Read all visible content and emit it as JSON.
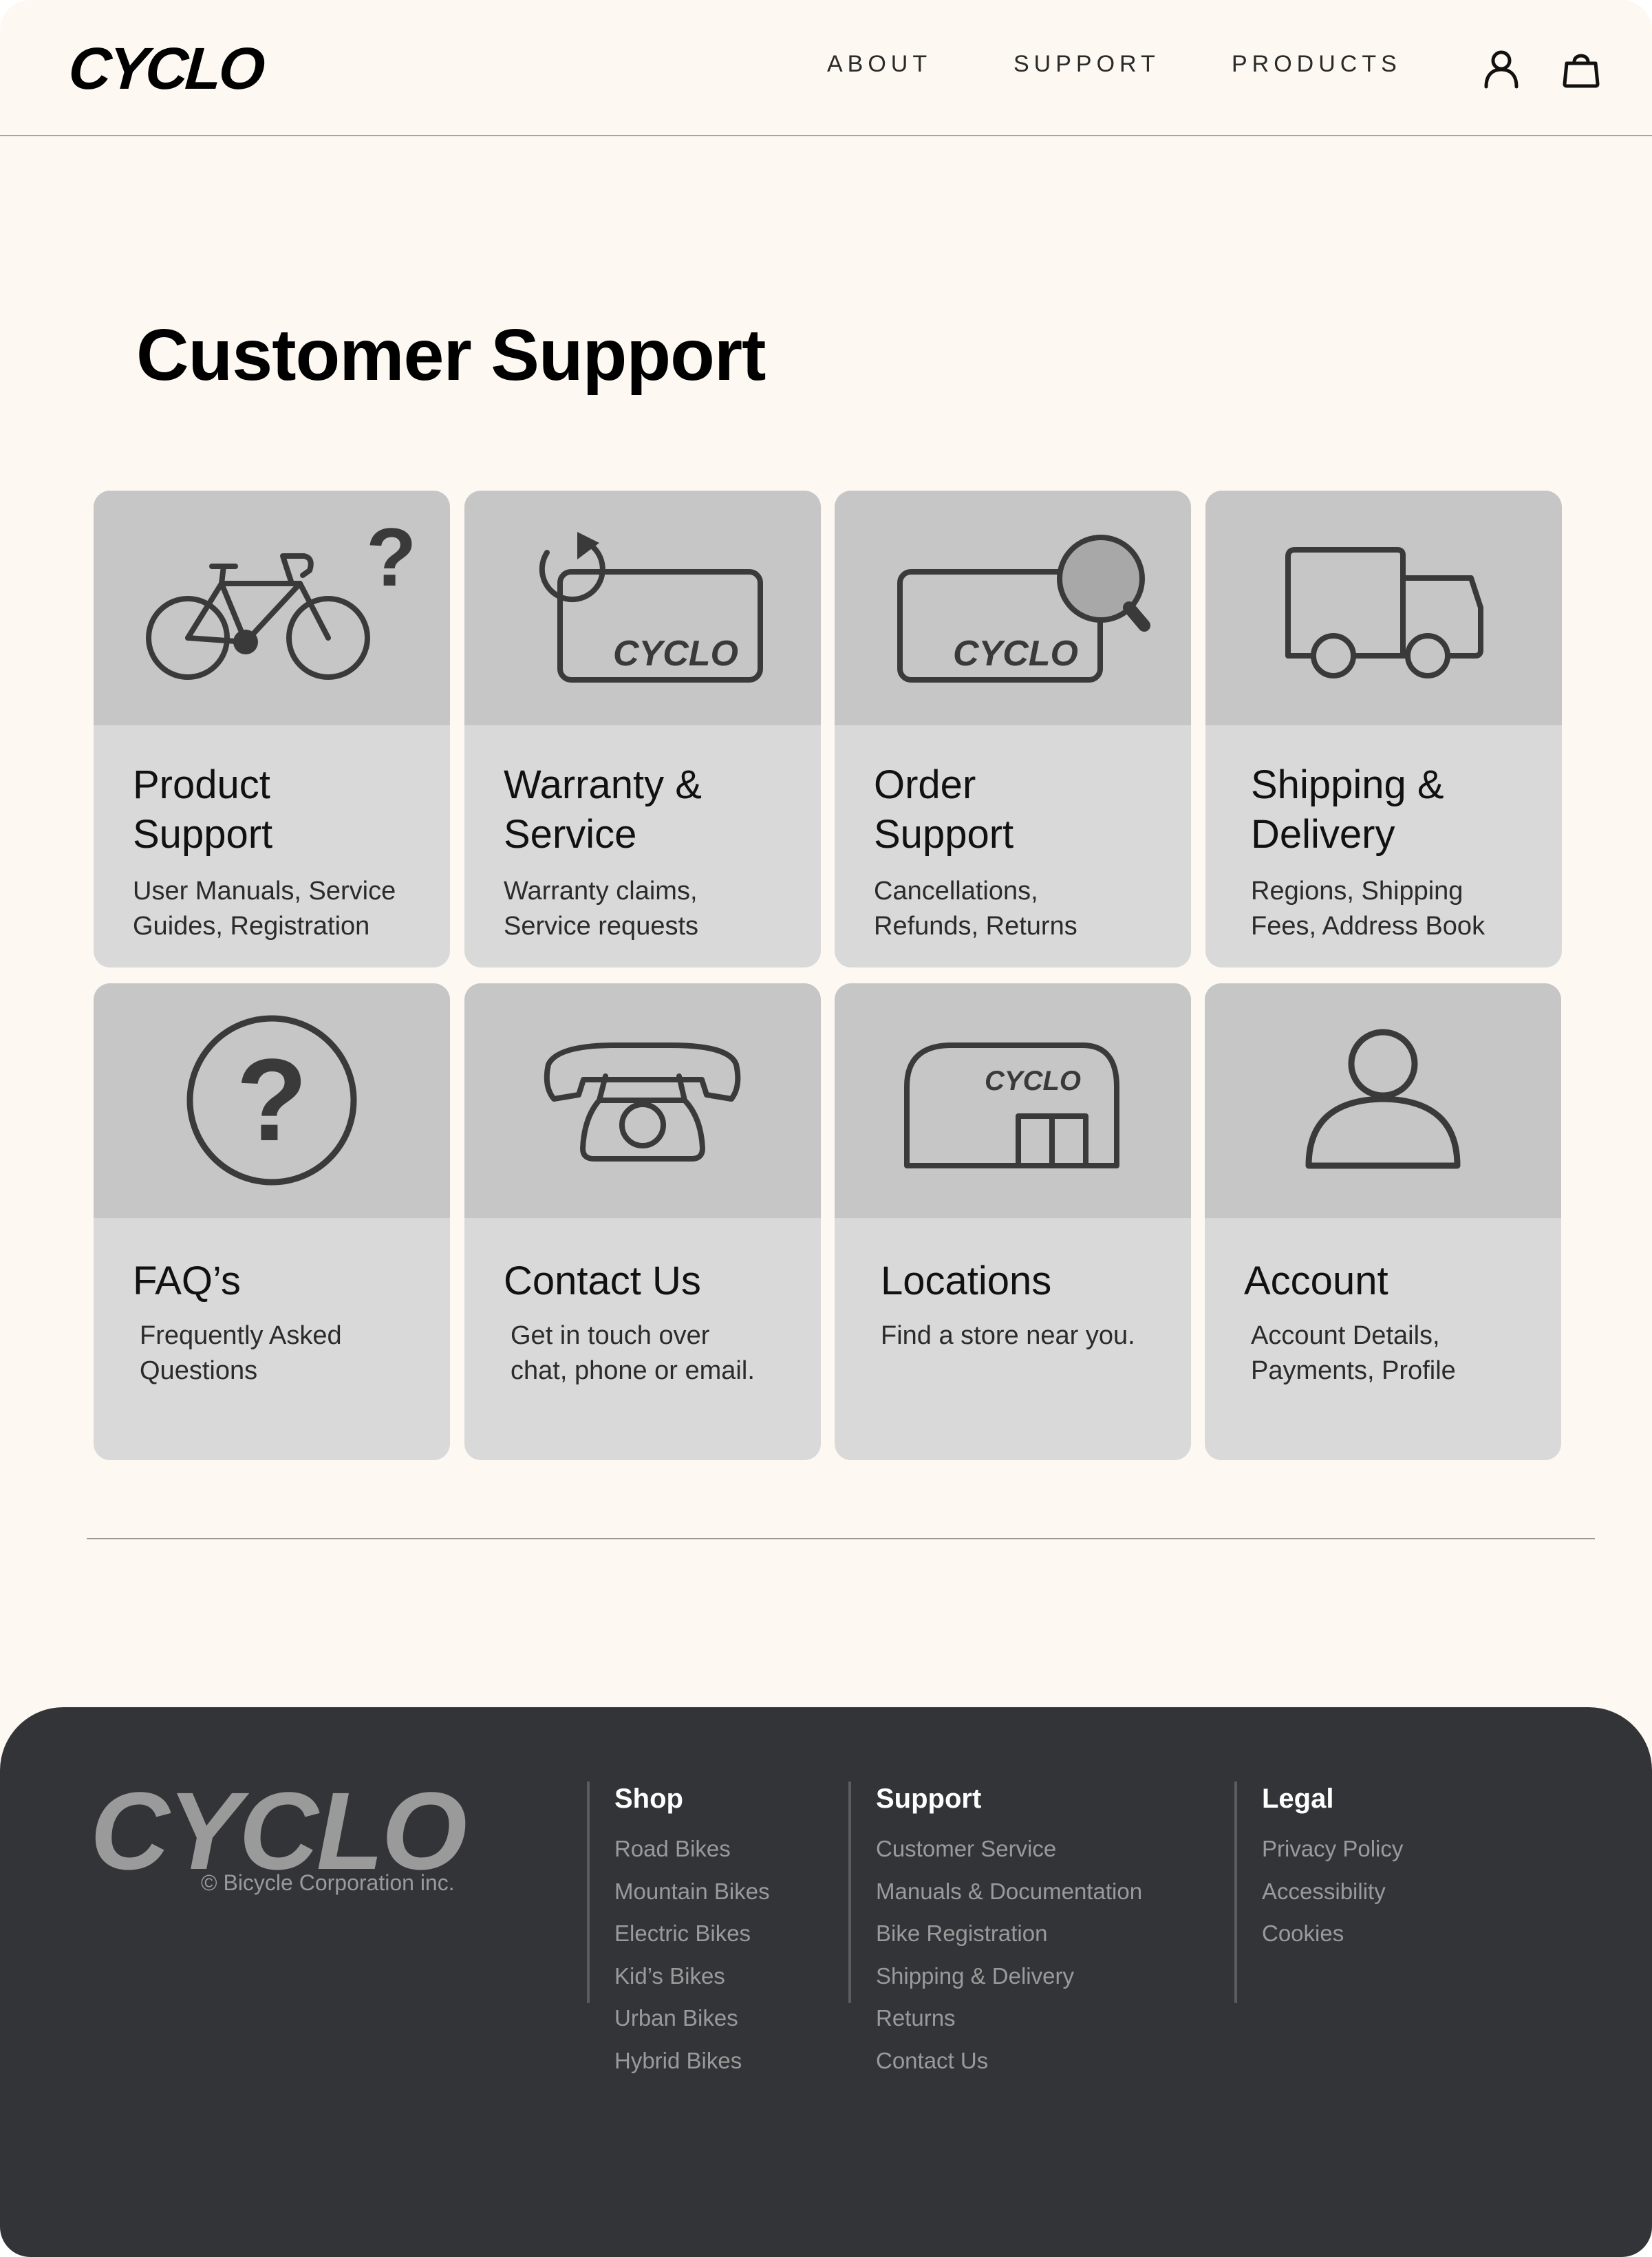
{
  "header": {
    "logo": "CYCLO",
    "nav": {
      "about": "ABOUT",
      "support": "SUPPORT",
      "products": "PRODUCTS"
    },
    "icons": [
      "account-icon",
      "shopping-bag-icon"
    ]
  },
  "main": {
    "title": "Customer Support",
    "cards": [
      {
        "title": "Product\nSupport",
        "description": "User Manuals, Service\nGuides, Registration",
        "icon": "bicycle-question-icon"
      },
      {
        "title": "Warranty &\nService",
        "description": "Warranty claims,\nService requests",
        "icon": "card-refresh-icon",
        "icon_text": "CYCLO"
      },
      {
        "title": "Order\nSupport",
        "description": "Cancellations,\nRefunds, Returns",
        "icon": "card-search-icon",
        "icon_text": "CYCLO"
      },
      {
        "title": "Shipping &\nDelivery",
        "description": "Regions, Shipping\nFees, Address Book",
        "icon": "truck-icon"
      },
      {
        "title": "FAQ’s",
        "description": "Frequently Asked\nQuestions",
        "icon": "question-circle-icon"
      },
      {
        "title": "Contact Us",
        "description": "Get in touch over\nchat, phone or email.",
        "icon": "telephone-icon"
      },
      {
        "title": "Locations",
        "description": "Find a store near you.",
        "icon": "store-icon",
        "icon_text": "CYCLO"
      },
      {
        "title": "Account",
        "description": "Account Details,\nPayments, Profile",
        "icon": "person-icon"
      }
    ]
  },
  "footer": {
    "logo": "CYCLO",
    "copyright": "© Bicycle Corporation inc.",
    "columns": [
      {
        "heading": "Shop",
        "links": [
          "Road Bikes",
          "Mountain Bikes",
          "Electric Bikes",
          "Kid’s Bikes",
          "Urban Bikes",
          "Hybrid Bikes"
        ]
      },
      {
        "heading": "Support",
        "links": [
          "Customer Service",
          "Manuals & Documentation",
          "Bike Registration",
          "Shipping & Delivery",
          "Returns",
          "Contact Us"
        ]
      },
      {
        "heading": "Legal",
        "links": [
          "Privacy Policy",
          "Accessibility",
          "Cookies"
        ]
      }
    ]
  },
  "colors": {
    "page_background": "#fdf9f2",
    "card_top": "#c6c6c6",
    "card_bottom": "#d9d9d9",
    "icon_stroke": "#3a3a3a",
    "footer_background": "#333438",
    "footer_text": "#9a9a9a"
  }
}
